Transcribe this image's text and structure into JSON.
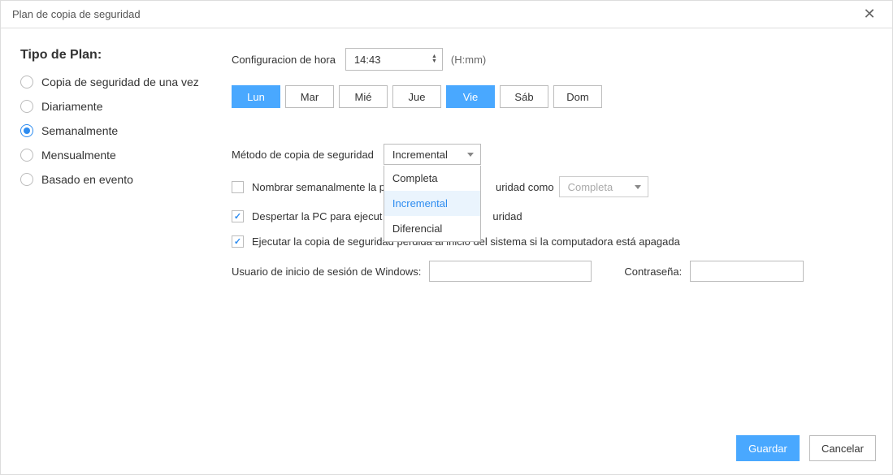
{
  "window": {
    "title": "Plan de copia de seguridad"
  },
  "sidebar": {
    "title": "Tipo de Plan:",
    "items": [
      {
        "label": "Copia de seguridad de una vez",
        "selected": false
      },
      {
        "label": "Diariamente",
        "selected": false
      },
      {
        "label": "Semanalmente",
        "selected": true
      },
      {
        "label": "Mensualmente",
        "selected": false
      },
      {
        "label": "Basado en evento",
        "selected": false
      }
    ]
  },
  "time": {
    "label": "Configuracion de hora",
    "value": "14:43",
    "suffix": "(H:mm)"
  },
  "days": [
    {
      "label": "Lun",
      "active": true
    },
    {
      "label": "Mar",
      "active": false
    },
    {
      "label": "Mié",
      "active": false
    },
    {
      "label": "Jue",
      "active": false
    },
    {
      "label": "Vie",
      "active": true
    },
    {
      "label": "Sáb",
      "active": false
    },
    {
      "label": "Dom",
      "active": false
    }
  ],
  "method": {
    "label": "Método de copia de seguridad",
    "selected": "Incremental",
    "options": [
      "Completa",
      "Incremental",
      "Diferencial"
    ]
  },
  "check_weekly": {
    "checked": false,
    "label_before": "Nombrar semanalmente la p",
    "label_after": "uridad como",
    "select_value": "Completa"
  },
  "check_wake": {
    "checked": true,
    "label_before": "Despertar la PC para ejecut",
    "label_after": "uridad"
  },
  "check_missed": {
    "checked": true,
    "label": "Ejecutar la copia de seguridad perdida al inicio del sistema si la computadora está apagada"
  },
  "login": {
    "user_label": "Usuario de inicio de sesión de Windows:",
    "user_value": "",
    "pass_label": "Contraseña:",
    "pass_value": ""
  },
  "footer": {
    "save": "Guardar",
    "cancel": "Cancelar"
  }
}
